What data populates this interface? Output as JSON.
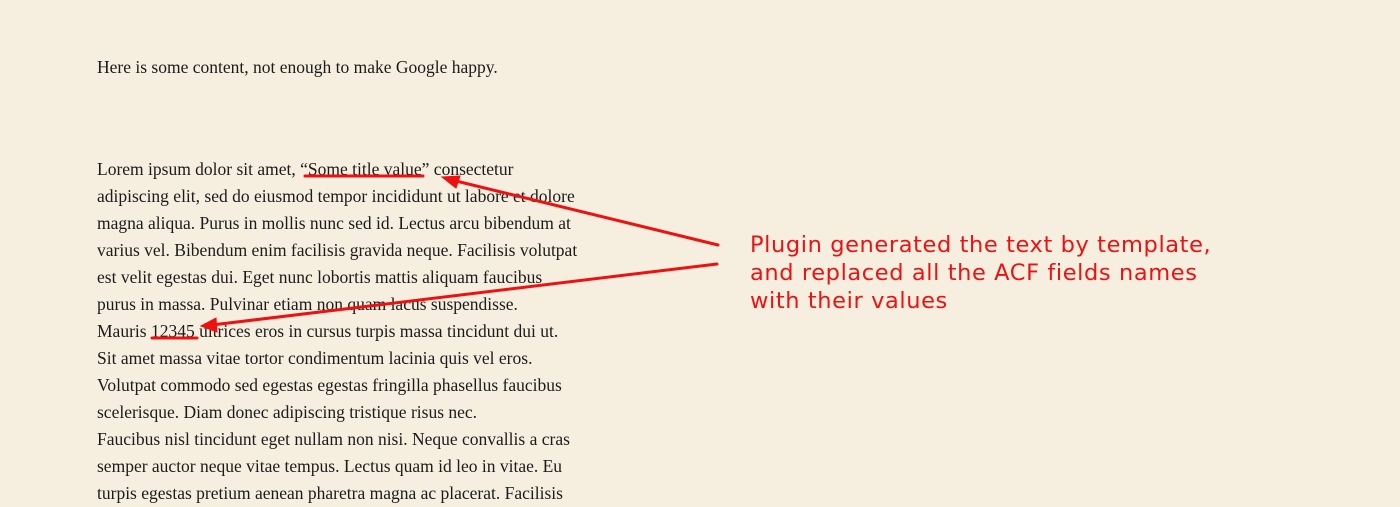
{
  "intro_text": "Here is some content, not enough to make Google happy.",
  "content_lines": [
    "Lorem ipsum dolor sit amet, “Some title value” consectetur",
    "adipiscing elit, sed do eiusmod tempor incididunt ut labore et dolore",
    "magna aliqua. Purus in mollis nunc sed id. Lectus arcu bibendum at",
    "varius vel. Bibendum enim facilisis gravida neque. Facilisis volutpat",
    "est velit egestas dui. Eget nunc lobortis mattis aliquam faucibus",
    "purus in massa. Pulvinar etiam non quam lacus suspendisse.",
    "Mauris 12345 ultrices eros in cursus turpis massa tincidunt dui ut.",
    "Sit amet massa vitae tortor condimentum lacinia quis vel eros.",
    "Volutpat commodo sed egestas egestas fringilla phasellus faucibus",
    "scelerisque. Diam donec adipiscing tristique risus nec.",
    "Faucibus nisl tincidunt eget nullam non nisi. Neque convallis a cras",
    "semper auctor neque vitae tempus. Lectus quam id leo in vitae. Eu",
    "turpis egestas pretium aenean pharetra magna ac placerat. Facilisis"
  ],
  "annotation": {
    "lines": [
      "Plugin generated the text by template,",
      "and replaced all the ACF fields names",
      "with their values"
    ],
    "color": "#ee1111"
  },
  "highlighted_values": [
    "“Some title value”",
    "12345"
  ]
}
